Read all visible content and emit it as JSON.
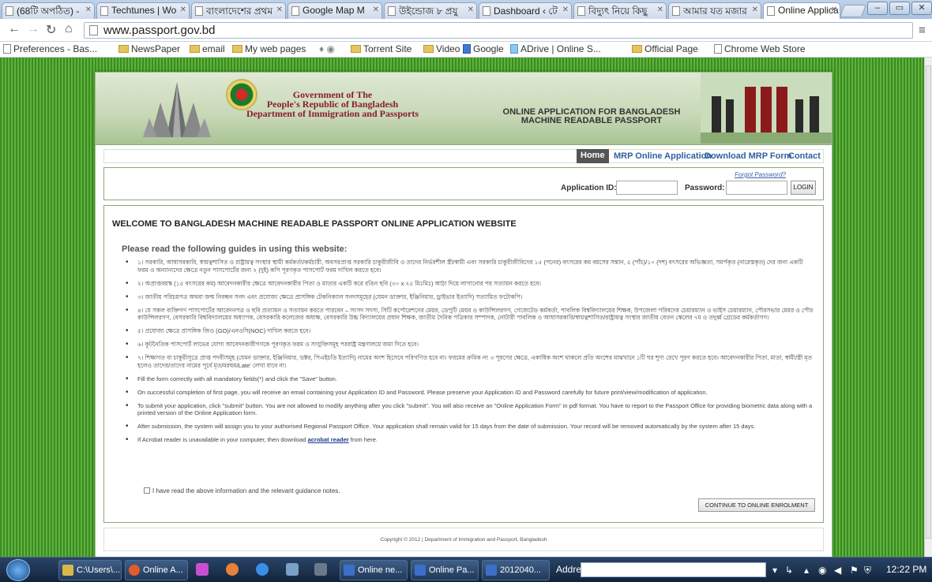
{
  "browser": {
    "tabs": [
      {
        "title": "(68টি অপঠিত) -"
      },
      {
        "title": "Techtunes | Wo"
      },
      {
        "title": "বাংলাদেশের প্রথম"
      },
      {
        "title": "Google Map M"
      },
      {
        "title": "উইন্ডোজ ৮ প্রযু"
      },
      {
        "title": "Dashboard ‹ টে"
      },
      {
        "title": "বিদ্যুৎ নিয়ে কিছু"
      },
      {
        "title": "আমার যত মজার"
      },
      {
        "title": "Online Applica"
      }
    ],
    "url": "www.passport.gov.bd",
    "bookmarks": [
      "Preferences - Bas...",
      "NewsPaper",
      "email",
      "My web pages",
      "Torrent Site",
      "Video",
      "Google",
      "ADrive | Online S...",
      "Official Page",
      "Chrome Web Store"
    ]
  },
  "site": {
    "gov_lines": [
      "Government of The",
      "People's Republic of Bangladesh",
      "Department of Immigration and Passports"
    ],
    "app_title_lines": [
      "ONLINE APPLICATION FOR BANGLADESH",
      "MACHINE READABLE PASSPORT"
    ],
    "nav": {
      "home": "Home",
      "mrp": "MRP Online Application",
      "download": "Download MRP Form",
      "contact": "Contact"
    },
    "login": {
      "forgot": "Forgot Password?",
      "app_id_label": "Application ID:",
      "password_label": "Password:",
      "login_button": "LOGIN"
    },
    "welcome": "WELCOME TO BANGLADESH MACHINE READABLE PASSPORT ONLINE APPLICATION WEBSITE",
    "guide_heading": "Please read the following guides in using this website:",
    "guides": [
      "১। সরকারি, আধাসরকারি, স্বায়ত্বশাসিত ও রাষ্ট্রায়ত্ব সংস্থার স্থায়ী কর্মকর্তা/কর্মচারী, অবসরপ্রাপ্ত সরকারি চাকুরীজীবি ও তাদের নির্ভরশীল স্ত্রী/স্বামী এবং সরকারি চাকুরীজীবিদের ১৫ (পনের) বৎসরের কম বয়সের সন্তান, ৫ (পাঁচ)/১০ (দশ) বৎসরের অভিজ্ঞতা, সমর্পকৃত (নারেস্তকৃত) দের জন্য একটি ফরম ও অন্যান্যদের ক্ষেত্রে নতুন পাসপোর্টের জন্য ২ (দুই) কপি পূরণকৃত পাসপোর্ট ফরম দাখিল করতে হবে।",
      "২। অপ্রাপ্তবয়স্ক (১৫ বৎসরের কম) আবেদনকারীর ক্ষেত্রে আবেদনকারীর পিতা ও মাতার একটি করে রঙিন ছবি (৩০ x ২৫ মিঃমিঃ) আঠা দিয়ে লাগানোর পর সত্যায়ন করতে হবে।",
      "৩। জাতীয় পরিচয়পত্র অথবা জন্ম নিবন্ধন সনদ এবং প্রযোজ্য ক্ষেত্রে প্রাসঙ্গিক টেকনিক্যাল সনদসমূহের (যেমন ডাক্তার, ইঞ্জিনিয়ার, ড্রাইভার ইত্যাদি) সত্যায়িত ফটোকপি।",
      "৪। যে সকল ব্যক্তিগণ পাসপোর্টের আবেদনপত্র ও ছবি প্রত্যায়ন ও সত্যায়ন করতে পারবেন – সংসদ সদস্য, সিটি কর্পোরেশনের মেয়র, ডেপুটি মেয়র ও কাউন্সিলরগণ, গেজেটেড কর্মকর্তা, পাবলিক বিশ্ববিদ্যালয়ের শিক্ষক, উপজেলা পরিষদের চেয়ারম্যান ও ভাইস চেয়ারম্যান, পৌরসভার মেয়র ও পৌর কাউন্সিলরগণ, বেসরকারি বিশ্ববিদ্যালয়ের অধ্যাপক, বেসরকারি কলেজের অধ্যক্ষ, বেসরকারি উচ্চ বিদ্যালয়ের প্রধান শিক্ষক, জাতীয় দৈনিক পত্রিকার সম্পাদক, নোটারী পাবলিক ও আধাসরকারি/স্বায়ত্বশাসিত/রাষ্ট্রায়ত্ব সংস্থার জাতীয় বেতন স্কেলের ৭ম ও তদুর্ধ্ব গ্রেডের কর্মকর্তাগণ।",
      "৫। প্রযোজ্য ক্ষেত্রে প্রাসঙ্গিক জিও (GO)/এনওসি(NOC) দাখিল করতে হবে।",
      "৬। কূটনৈতিক পাসপোর্ট লাভের যোগ্য আবেদনকারীগণকে পূরণকৃত ফরম ও সংযুক্তিসমূহ পররাষ্ট্র মন্ত্রণালয়ে জমা দিতে হবে।",
      "৭। শিক্ষাগত বা চাকুরীসূত্রে প্রাপ্ত পদবীসমূহ (যেমন ডাক্তার, ইঞ্জিনিয়ার, ডক্টর, পিএইচডি ইত্যাদি) নামের অংশ হিসেবে পরিগণিত হবে না। ফরমের ক্রমিক নং ৩ পূরণের ক্ষেত্রে, একাধিক অংশ থাকলে প্রতি অংশের মাঝখানে ১টি ঘর শূণ্য রেখে পূরণ করতে হবে। আবেদনকারীর পিতা, মাতা, স্বামী/স্ত্রী মৃত হলেও তাদের/তাদের নামের পূর্বে মৃত/মরহুম/Late' লেখা যাবে না।",
      "Fill the form correctly with all mandatory fields(*) and click the \"Save\" button.",
      "On successful completion of first page, you will receive an email containing your Application ID and Password. Please preserve your Application ID and Password carefully for future print/view/modification of application.",
      "To submit your application, click \"submit\" button. You are not allowed to modify anything after you click \"submit\". You will also receive an \"Online Application Form\" in pdf format. You have to report to the Passport Office for providing biometric data along with a printed version of the Online Application form.",
      "After submission, the system will assign you to your authorised Regional Passport Office. Your application shall remain valid for 15 days from the date of submission. Your record will be removed automatically by the system after 15 days."
    ],
    "acrobat_prefix": "If Acrobat reader is unavailable in your computer, then download",
    "acrobat_link": "acrobat reader",
    "acrobat_suffix": "from here.",
    "agree_text": "I have read the above information and the relevant guidance notes.",
    "continue_button": "CONTINUE TO ONLINE ENROLMENT",
    "footer": "Copyright © 2012 | Department of Immigration and Passport, Bangladesh"
  },
  "taskbar": {
    "items": [
      "C:\\Users\\...",
      "Online A...",
      "Online ne...",
      "Online Pa...",
      "2012040..."
    ],
    "address_label": "Address",
    "clock": "12:22 PM"
  },
  "colors": {
    "accent_green": "#3d8a24",
    "nav_link": "#2f5f9f",
    "gov_red": "#8a1c2e"
  }
}
